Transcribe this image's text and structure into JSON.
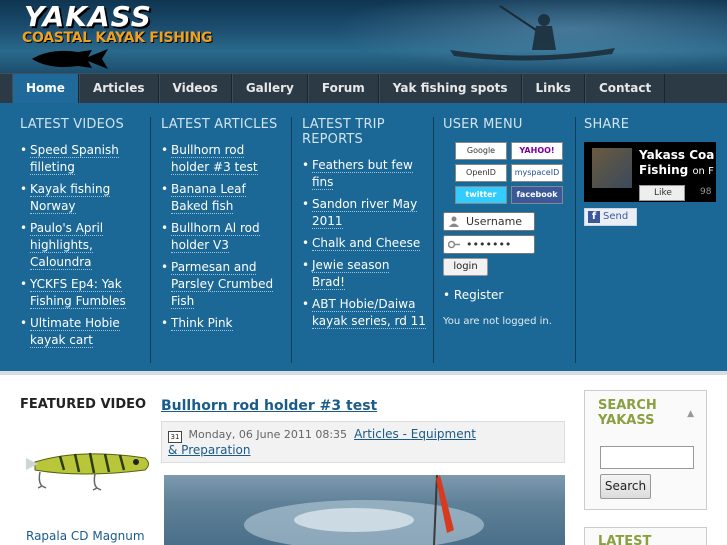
{
  "header": {
    "logo_title": "YAKASS",
    "logo_subtitle": "COASTAL KAYAK FISHING"
  },
  "nav": {
    "items": [
      {
        "label": "Home",
        "active": true
      },
      {
        "label": "Articles"
      },
      {
        "label": "Videos"
      },
      {
        "label": "Gallery"
      },
      {
        "label": "Forum"
      },
      {
        "label": "Yak fishing spots"
      },
      {
        "label": "Links"
      },
      {
        "label": "Contact"
      }
    ]
  },
  "latest_videos": {
    "title": "LATEST VIDEOS",
    "items": [
      "Speed Spanish filleting",
      "Kayak fishing Norway",
      "Paulo's April highlights, Caloundra",
      "YCKFS Ep4: Yak Fishing Fumbles",
      "Ultimate Hobie kayak cart"
    ]
  },
  "latest_articles": {
    "title": "LATEST ARTICLES",
    "items": [
      "Bullhorn rod holder #3 test",
      "Banana Leaf Baked fish",
      "Bullhorn Al rod holder V3",
      "Parmesan and Parsley Crumbed Fish",
      "Think Pink"
    ]
  },
  "latest_trips": {
    "title": "LATEST TRIP REPORTS",
    "items": [
      "Feathers but few fins",
      "Sandon river May 2011",
      "Chalk and Cheese",
      "Jewie season Brad!",
      "ABT Hobie/Daiwa kayak series, rd 11"
    ]
  },
  "user_menu": {
    "title": "USER MENU",
    "providers": [
      "Google",
      "YAHOO!",
      "OpenID",
      "myspaceID",
      "twitter",
      "facebook"
    ],
    "username_placeholder": "Username",
    "password_placeholder": "•••••••",
    "login_label": "login",
    "register_label": "Register",
    "status": "You are not logged in."
  },
  "share": {
    "title": "SHARE",
    "page_name": "Yakass Coa",
    "page_name2": "Fishing",
    "on_label": "on F",
    "like_label": "Like",
    "like_count": "98",
    "send_label": "Send"
  },
  "featured": {
    "title": "FEATURED VIDEO",
    "caption": "Rapala CD Magnum"
  },
  "article": {
    "title": "Bullhorn rod holder #3 test",
    "date": "Monday, 06 June 2011 08:35",
    "cal_day": "31",
    "category1": "Articles",
    "category_sep": " - ",
    "category2a": "Equipment",
    "category2b": "& Preparation"
  },
  "sidebar": {
    "search_title": "SEARCH YAKASS",
    "search_button": "Search",
    "latest_title": "LATEST"
  },
  "colors": {
    "panel": "#1b6896",
    "nav": "#2b3a44",
    "nav_active": "#1f6a9a",
    "link": "#1a5b8a",
    "sidebar_heading": "#8aa040"
  }
}
